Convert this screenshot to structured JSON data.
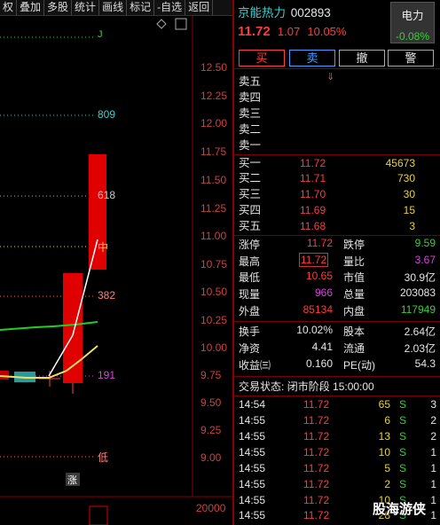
{
  "toolbar": {
    "items": [
      "权",
      "叠加",
      "多股",
      "统计",
      "画线",
      "标记",
      "-自选",
      "返回"
    ]
  },
  "chart": {
    "price_axis": [
      "12.50",
      "12.25",
      "12.00",
      "11.75",
      "11.50",
      "11.25",
      "11.00",
      "10.75",
      "10.50",
      "10.25",
      "10.00",
      "9.75",
      "9.50",
      "9.25",
      "9.00"
    ],
    "volume_axis": "20000",
    "levels": [
      {
        "label": "809",
        "color": "#3ad0d0"
      },
      {
        "label": "618",
        "color": "#c8c8c8"
      },
      {
        "label": "中",
        "color": "#e8d23a"
      },
      {
        "label": "382",
        "color": "#ff8080"
      },
      {
        "label": "191",
        "color": "#e040e0"
      },
      {
        "label": "低",
        "color": "#ff8080"
      }
    ],
    "limit_up_tag": "涨",
    "top_tag": "J"
  },
  "stock": {
    "name": "京能热力",
    "code": "002893",
    "sector": "电力",
    "sector_change": "-0.08%",
    "price": "11.72",
    "change": "1.07",
    "change_pct": "10.05%"
  },
  "buttons": {
    "buy": "买",
    "sell": "卖",
    "cancel": "撤",
    "alert": "警"
  },
  "collapse_icon": "double-chevron-down",
  "asks": [
    {
      "label": "卖五"
    },
    {
      "label": "卖四"
    },
    {
      "label": "卖三"
    },
    {
      "label": "卖二"
    },
    {
      "label": "卖一"
    }
  ],
  "bids": [
    {
      "label": "买一",
      "price": "11.72",
      "vol": "45673"
    },
    {
      "label": "买二",
      "price": "11.71",
      "vol": "730"
    },
    {
      "label": "买三",
      "price": "11.70",
      "vol": "30"
    },
    {
      "label": "买四",
      "price": "11.69",
      "vol": "15"
    },
    {
      "label": "买五",
      "price": "11.68",
      "vol": "3"
    }
  ],
  "stats": {
    "limit_up_label": "涨停",
    "limit_up": "11.72",
    "limit_down_label": "跌停",
    "limit_down": "9.59",
    "high_label": "最高",
    "high": "11.72",
    "vol_ratio_label": "量比",
    "vol_ratio": "3.67",
    "low_label": "最低",
    "low": "10.65",
    "mcap_label": "市值",
    "mcap": "30.9亿",
    "cur_vol_label": "现量",
    "cur_vol": "966",
    "total_vol_label": "总量",
    "total_vol": "203083",
    "outer_label": "外盘",
    "outer": "85134",
    "inner_label": "内盘",
    "inner": "117949",
    "turnover_label": "换手",
    "turnover": "10.02%",
    "share_cap_label": "股本",
    "share_cap": "2.64亿",
    "nav_label": "净资",
    "nav": "4.41",
    "float_label": "流通",
    "float": "2.03亿",
    "eps_label": "收益㈢",
    "eps": "0.160",
    "pe_label": "PE(动)",
    "pe": "54.3"
  },
  "trade_status": {
    "label": "交易状态:",
    "value": "闭市阶段 15:00:00"
  },
  "ticks": [
    {
      "time": "14:54",
      "price": "11.72",
      "vol": "65",
      "side": "S",
      "num": "3"
    },
    {
      "time": "14:55",
      "price": "11.72",
      "vol": "6",
      "side": "S",
      "num": "2"
    },
    {
      "time": "14:55",
      "price": "11.72",
      "vol": "13",
      "side": "S",
      "num": "2"
    },
    {
      "time": "14:55",
      "price": "11.72",
      "vol": "10",
      "side": "S",
      "num": "1"
    },
    {
      "time": "14:55",
      "price": "11.72",
      "vol": "5",
      "side": "S",
      "num": "1"
    },
    {
      "time": "14:55",
      "price": "11.72",
      "vol": "2",
      "side": "S",
      "num": "1"
    },
    {
      "time": "14:55",
      "price": "11.72",
      "vol": "10",
      "side": "S",
      "num": "1"
    },
    {
      "time": "14:55",
      "price": "11.72",
      "vol": "28",
      "side": "S",
      "num": "1"
    }
  ],
  "watermark": "股海游侠"
}
